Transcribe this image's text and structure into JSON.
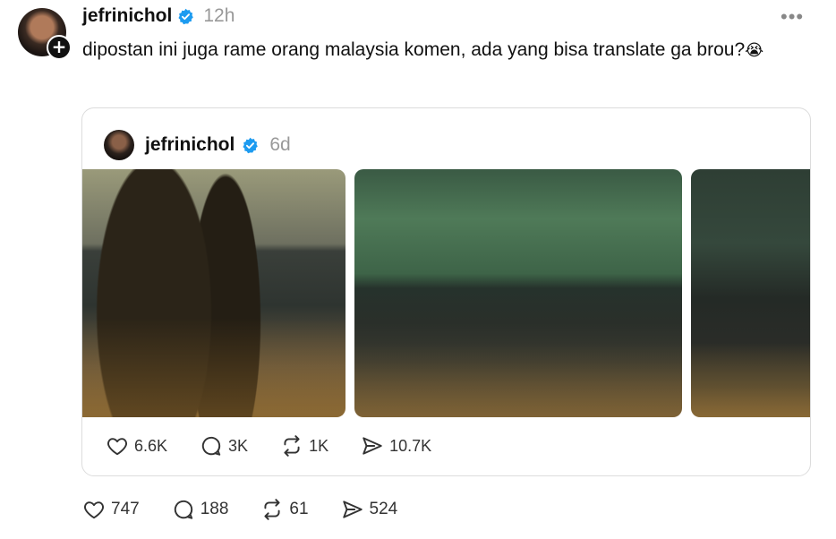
{
  "post": {
    "username": "jefrinichol",
    "time": "12h",
    "text": "dipostan ini juga rame orang malaysia komen, ada yang bisa translate ga brou?",
    "emoji": "😭",
    "more_label": "•••",
    "follow_badge": "+"
  },
  "quoted": {
    "username": "jefrinichol",
    "time": "6d",
    "stats": {
      "likes": "6.6K",
      "replies": "3K",
      "reposts": "1K",
      "shares": "10.7K"
    }
  },
  "stats": {
    "likes": "747",
    "replies": "188",
    "reposts": "61",
    "shares": "524"
  },
  "colors": {
    "verified": "#1d9bf0",
    "muted": "#999999"
  },
  "icons": [
    "heart-icon",
    "reply-icon",
    "repost-icon",
    "share-icon",
    "verified-badge-icon",
    "more-icon"
  ]
}
